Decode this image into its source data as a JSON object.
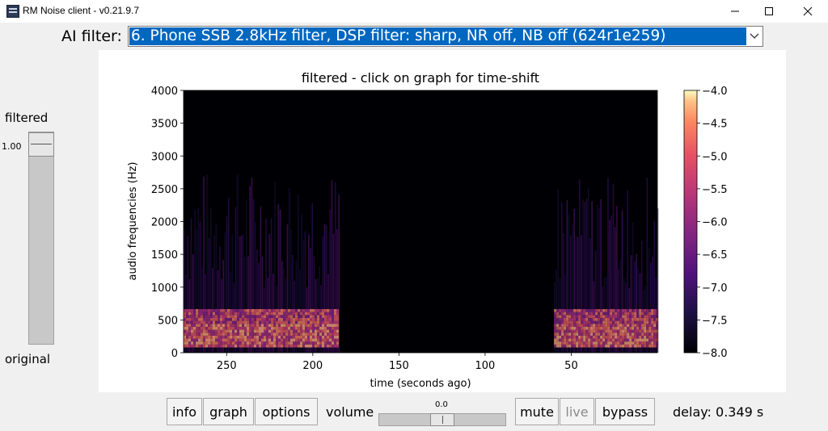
{
  "window": {
    "title": "RM Noise client - v0.21.9.7",
    "icons": [
      "app-icon",
      "minimize-icon",
      "maximize-icon",
      "close-icon"
    ]
  },
  "ai_filter": {
    "label": "AI filter:",
    "selected": "6. Phone SSB 2.8kHz filter, DSP filter: sharp, NR off, NB off (624r1e259)"
  },
  "mix_slider": {
    "top_label": "filtered",
    "bottom_label": "original",
    "value_text": "1.00",
    "value": 1.0
  },
  "chart_data": {
    "type": "heatmap",
    "title": "filtered - click on graph for time-shift",
    "xlabel": "time (seconds ago)",
    "ylabel": "audio frequencies (Hz)",
    "x_ticks": [
      "250",
      "200",
      "150",
      "100",
      "50"
    ],
    "y_ticks": [
      "0",
      "500",
      "1000",
      "1500",
      "2000",
      "2500",
      "3000",
      "3500",
      "4000"
    ],
    "xlim": [
      275,
      0
    ],
    "ylim": [
      0,
      4000
    ],
    "colorbar": {
      "ticks": [
        "−4.0",
        "−4.5",
        "−5.0",
        "−5.5",
        "−6.0",
        "−6.5",
        "−7.0",
        "−7.5",
        "−8.0"
      ],
      "range": [
        -8.0,
        -4.0
      ],
      "colormap": "magma"
    },
    "activity_segments": [
      {
        "start": 275,
        "end": 185,
        "max_freq": 2800
      },
      {
        "start": 60,
        "end": 0,
        "max_freq": 2700
      }
    ]
  },
  "controls": {
    "info": "info",
    "graph": "graph",
    "options": "options",
    "volume_label": "volume",
    "volume_value_text": "0.0",
    "volume_value": 0.0,
    "mute": "mute",
    "live": "live",
    "bypass": "bypass",
    "delay": "delay: 0.349 s"
  }
}
